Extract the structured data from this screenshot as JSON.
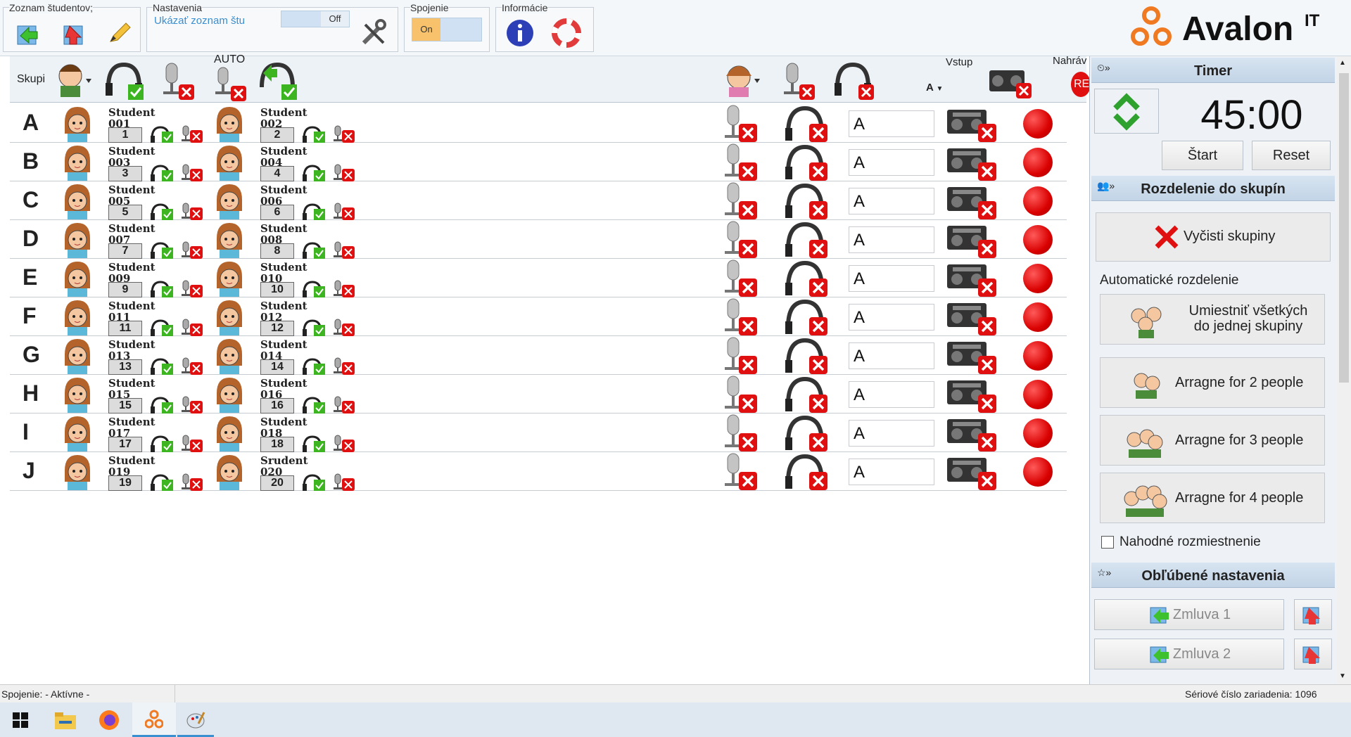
{
  "ribbon": {
    "groups": {
      "students": {
        "title": "Zoznam študentov;"
      },
      "settings": {
        "title": "Nastavenia",
        "show_list": "Ukázať zoznam štu",
        "toggle": "Off"
      },
      "connection": {
        "title": "Spojenie",
        "toggle": "On"
      },
      "info": {
        "title": "Informácie"
      }
    },
    "logo": {
      "brand": "Avalon",
      "sup": "IT"
    }
  },
  "header": {
    "groups_label": "Skupi",
    "auto_label": "AUTO",
    "input_label": "Vstup",
    "input_value": "A",
    "record_label": "Nahráv",
    "rec_badge": "RE"
  },
  "rows": [
    {
      "letter": "A",
      "s1": {
        "name": "Student",
        "id": "001",
        "num": "1"
      },
      "s2": {
        "name": "Student",
        "id": "002",
        "num": "2"
      },
      "input": "A"
    },
    {
      "letter": "B",
      "s1": {
        "name": "Student",
        "id": "003",
        "num": "3"
      },
      "s2": {
        "name": "Student",
        "id": "004",
        "num": "4"
      },
      "input": "A"
    },
    {
      "letter": "C",
      "s1": {
        "name": "Student",
        "id": "005",
        "num": "5"
      },
      "s2": {
        "name": "Student",
        "id": "006",
        "num": "6"
      },
      "input": "A"
    },
    {
      "letter": "D",
      "s1": {
        "name": "Student",
        "id": "007",
        "num": "7"
      },
      "s2": {
        "name": "Student",
        "id": "008",
        "num": "8"
      },
      "input": "A"
    },
    {
      "letter": "E",
      "s1": {
        "name": "Student",
        "id": "009",
        "num": "9"
      },
      "s2": {
        "name": "Student",
        "id": "010",
        "num": "10"
      },
      "input": "A"
    },
    {
      "letter": "F",
      "s1": {
        "name": "Student",
        "id": "011",
        "num": "11"
      },
      "s2": {
        "name": "Student",
        "id": "012",
        "num": "12"
      },
      "input": "A"
    },
    {
      "letter": "G",
      "s1": {
        "name": "Student",
        "id": "013",
        "num": "13"
      },
      "s2": {
        "name": "Student",
        "id": "014",
        "num": "14"
      },
      "input": "A"
    },
    {
      "letter": "H",
      "s1": {
        "name": "Student",
        "id": "015",
        "num": "15"
      },
      "s2": {
        "name": "Student",
        "id": "016",
        "num": "16"
      },
      "input": "A"
    },
    {
      "letter": "I",
      "s1": {
        "name": "Student",
        "id": "017",
        "num": "17"
      },
      "s2": {
        "name": "Student",
        "id": "018",
        "num": "18"
      },
      "input": "A"
    },
    {
      "letter": "J",
      "s1": {
        "name": "Student",
        "id": "019",
        "num": "19"
      },
      "s2": {
        "name": "Srudent",
        "id": "020",
        "num": "20"
      },
      "input": "A"
    }
  ],
  "panel": {
    "timer": {
      "title": "Timer",
      "value": "45:00",
      "start": "Štart",
      "reset": "Reset"
    },
    "groups": {
      "title": "Rozdelenie do skupín",
      "clear": "Vyčisti skupiny",
      "auto_title": "Automatické rozdelenie",
      "all_one_line1": "Umiestniť všetkých",
      "all_one_line2": "do jednej skupiny",
      "arr2": "Arragne for 2 people",
      "arr3": "Arragne for 3 people",
      "arr4": "Arragne for 4 people",
      "random": "Nahodné rozmiestnenie"
    },
    "favorites": {
      "title": "Obľúbené nastavenia",
      "items": [
        "Zmluva 1",
        "Zmluva 2"
      ]
    }
  },
  "status": {
    "left": "Spojenie: - Aktívne -",
    "right": "Sériové číslo zariadenia: 1096"
  },
  "colors": {
    "accent": "#3a8fd0",
    "danger": "#e01010",
    "ok": "#3cb521",
    "logo": "#f07a22"
  }
}
